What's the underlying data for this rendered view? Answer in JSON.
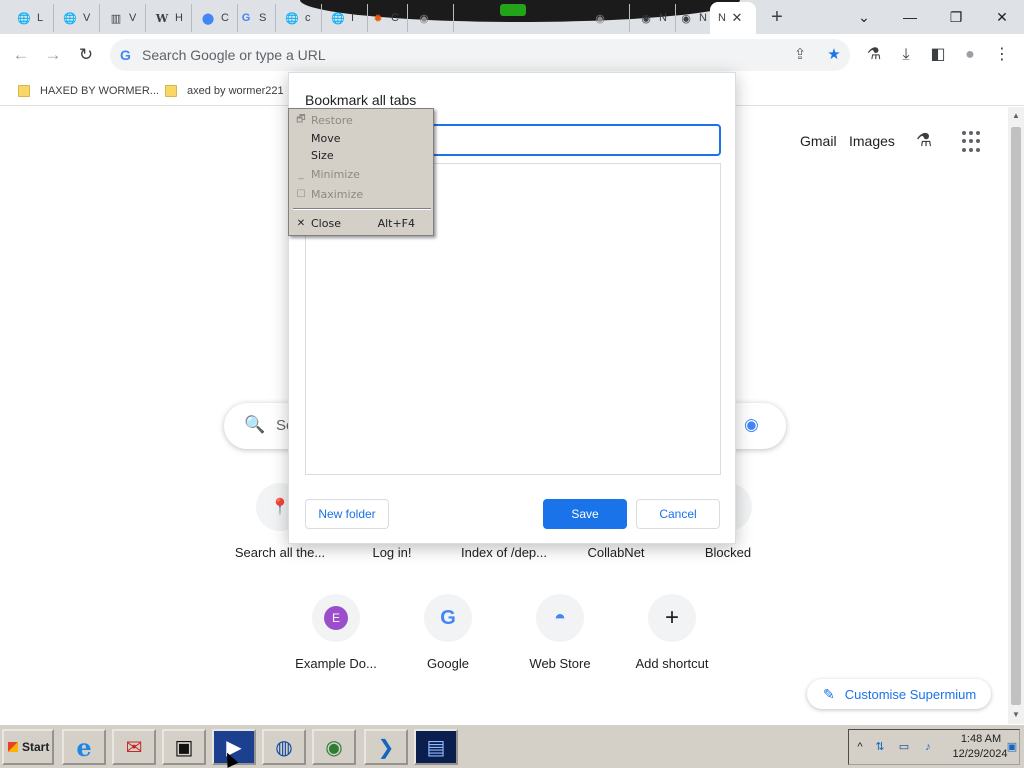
{
  "tabs": [
    {
      "label": "L",
      "icon": "globe-icon"
    },
    {
      "label": "V",
      "icon": "globe-icon"
    },
    {
      "label": "V",
      "icon": "library-icon"
    },
    {
      "label": "H",
      "icon": "wikipedia-icon"
    },
    {
      "label": "C",
      "icon": "map-pin-icon"
    },
    {
      "label": "S",
      "icon": "google-icon"
    },
    {
      "label": "c",
      "icon": "globe-icon"
    },
    {
      "label": "I",
      "icon": "globe-icon"
    },
    {
      "label": "C",
      "icon": "sun-icon"
    },
    {
      "label": "",
      "icon": "chromium-icon"
    },
    {
      "label": "",
      "icon": "globe-icon"
    },
    {
      "label": "",
      "icon": "globe-icon"
    },
    {
      "label": "",
      "icon": "chromium-icon"
    },
    {
      "label": "N",
      "icon": "chromium-icon"
    },
    {
      "label": "N",
      "icon": "chromium-icon"
    }
  ],
  "tab_strip": {
    "close_glyph": "✕",
    "new_tab_glyph": "+",
    "minimize_glyph": "—",
    "restore_glyph": "❐",
    "close_window_glyph": "✕",
    "tabs_dropdown_glyph": "⌄"
  },
  "toolbar": {
    "back_glyph": "←",
    "forward_glyph": "→",
    "reload_glyph": "↻",
    "omnibox_g": "G",
    "omnibox_placeholder": "Search Google or type a URL",
    "share_glyph": "⇪",
    "star_glyph": "★",
    "labs_glyph": "⚗",
    "download_glyph": "⤓",
    "sidepanel_glyph": "◧",
    "profile_glyph": "●",
    "menu_glyph": "⋮"
  },
  "bookmarks_bar": {
    "items": [
      {
        "label": "HAXED BY WORMER..."
      },
      {
        "label": "axed by wormer221"
      }
    ]
  },
  "ntp": {
    "gmail": "Gmail",
    "images": "Images",
    "labs_glyph": "⚗",
    "search_placeholder": "Se",
    "search_glyph": "🔍",
    "lens_glyph": "◉",
    "shortcuts_row1": [
      {
        "label": "Search all the...",
        "glyph": "📍"
      },
      {
        "label": "Log in!",
        "glyph": ""
      },
      {
        "label": "Index of /dep...",
        "glyph": ""
      },
      {
        "label": "CollabNet",
        "glyph": ""
      },
      {
        "label": "Blocked",
        "glyph": ""
      }
    ],
    "shortcuts_row2": [
      {
        "label": "Example Do...",
        "glyph": "E"
      },
      {
        "label": "Google",
        "glyph": "G"
      },
      {
        "label": "Web Store",
        "glyph": "◓"
      },
      {
        "label": "Add shortcut",
        "glyph": "+"
      }
    ],
    "customise_label": "Customise Supermium",
    "customise_glyph": "✎"
  },
  "dialog": {
    "title": "Bookmark all tabs",
    "new_folder": "New folder",
    "save": "Save",
    "cancel": "Cancel"
  },
  "sysmenu": {
    "items": [
      {
        "label": "Restore",
        "glyph": "🗗",
        "shortcut": "",
        "disabled": true
      },
      {
        "label": "Move",
        "glyph": "",
        "shortcut": "",
        "disabled": false
      },
      {
        "label": "Size",
        "glyph": "",
        "shortcut": "",
        "disabled": false
      },
      {
        "label": "Minimize",
        "glyph": "_",
        "shortcut": "",
        "disabled": true
      },
      {
        "label": "Maximize",
        "glyph": "☐",
        "shortcut": "",
        "disabled": true
      },
      {
        "label": "Close",
        "glyph": "✕",
        "shortcut": "Alt+F4",
        "disabled": false
      }
    ]
  },
  "taskbar": {
    "start_label": "Start",
    "apps": [
      {
        "name": "internet-explorer-icon",
        "glyph": "e"
      },
      {
        "name": "mail-app-icon",
        "glyph": "✉"
      },
      {
        "name": "terminal-app-icon",
        "glyph": "▣"
      },
      {
        "name": "media-player-icon",
        "glyph": "▶"
      },
      {
        "name": "globe-app-icon",
        "glyph": "◍"
      },
      {
        "name": "browser-app-icon",
        "glyph": "◉"
      },
      {
        "name": "powershell-icon",
        "glyph": "❯"
      },
      {
        "name": "device-app-icon",
        "glyph": "▤"
      }
    ],
    "tray_chevron": "^",
    "tray_icons": [
      {
        "name": "network-icon",
        "glyph": "⇅"
      },
      {
        "name": "monitor-icon",
        "glyph": "▭"
      },
      {
        "name": "volume-icon",
        "glyph": "♪"
      },
      {
        "name": "notification-icon",
        "glyph": "▣"
      }
    ],
    "clock_time": "1:48 AM",
    "clock_date": "12/29/2024"
  },
  "colors": {
    "accent": "#1a73e8",
    "tab_strip_bg": "#dee1e6",
    "taskbar_bg": "#d4d0c8"
  }
}
